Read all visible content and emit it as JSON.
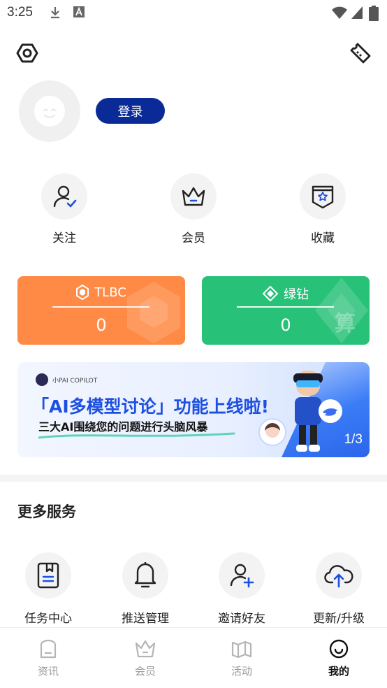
{
  "status_bar": {
    "time": "3:25"
  },
  "top_bar": {
    "settings_icon": "hexagon-settings-icon",
    "scan_icon": "ticket-scan-icon"
  },
  "profile": {
    "login_label": "登录"
  },
  "quick_actions": [
    {
      "label": "关注",
      "icon": "user-check-icon"
    },
    {
      "label": "会员",
      "icon": "crown-icon"
    },
    {
      "label": "收藏",
      "icon": "favorite-star-icon"
    }
  ],
  "cards": {
    "tlbc": {
      "title": "TLBC",
      "value": "0",
      "color": "#ff8a45"
    },
    "green": {
      "title": "绿钻",
      "value": "0",
      "color": "#27c178",
      "deco_text": "算"
    }
  },
  "banner": {
    "brand": "小PAI COPILOT",
    "headline": "「AI多模型讨论」功能上线啦!",
    "subline": "三大AI围绕您的问题进行头脑风暴",
    "pager": "1/3"
  },
  "more_services": {
    "title": "更多服务",
    "items": [
      {
        "label": "任务中心",
        "icon": "task-book-icon"
      },
      {
        "label": "推送管理",
        "icon": "bell-icon"
      },
      {
        "label": "邀请好友",
        "icon": "add-user-icon"
      },
      {
        "label": "更新/升级",
        "icon": "cloud-upload-icon"
      }
    ]
  },
  "tabs": [
    {
      "label": "资讯",
      "icon": "news-icon",
      "active": false
    },
    {
      "label": "会员",
      "icon": "crown-icon",
      "active": false
    },
    {
      "label": "活动",
      "icon": "map-icon",
      "active": false
    },
    {
      "label": "我的",
      "icon": "smile-icon",
      "active": true
    }
  ]
}
